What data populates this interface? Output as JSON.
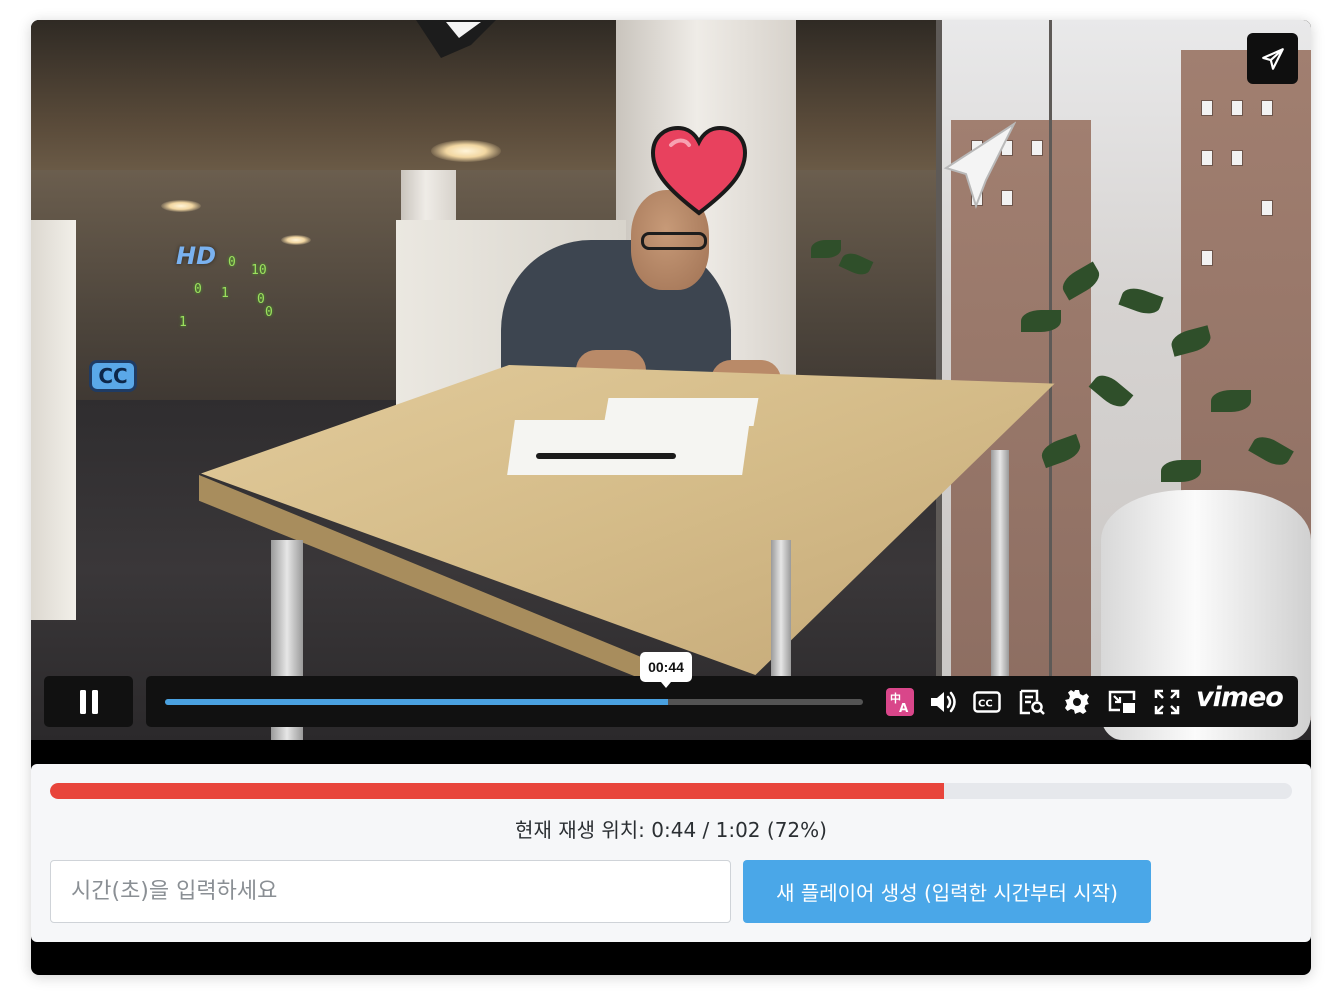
{
  "player": {
    "overlay_stickers": {
      "hd": "HD",
      "cc": "CC",
      "binary": [
        "0",
        "10",
        "0",
        "1",
        "0",
        "1",
        "0"
      ]
    },
    "controls": {
      "tooltip_time": "00:44",
      "progress_fraction": 0.72,
      "icons": [
        "translate-icon",
        "volume-icon",
        "cc-icon",
        "transcript-icon",
        "settings-icon",
        "pip-icon",
        "fullscreen-icon"
      ],
      "logo": "vimeo",
      "accent_color": "#4aa1e0"
    },
    "share_icon": "paper-plane-icon"
  },
  "panel": {
    "progress_fraction": 0.72,
    "progress_color": "#e8453c",
    "status_text": "현재 재생 위치: 0:44 / 1:02 (72%)",
    "input": {
      "value": "",
      "placeholder": "시간(초)을 입력하세요"
    },
    "create_button_label": "새 플레이어 생성 (입력한 시간부터 시작)",
    "create_button_color": "#4aa7e8"
  }
}
